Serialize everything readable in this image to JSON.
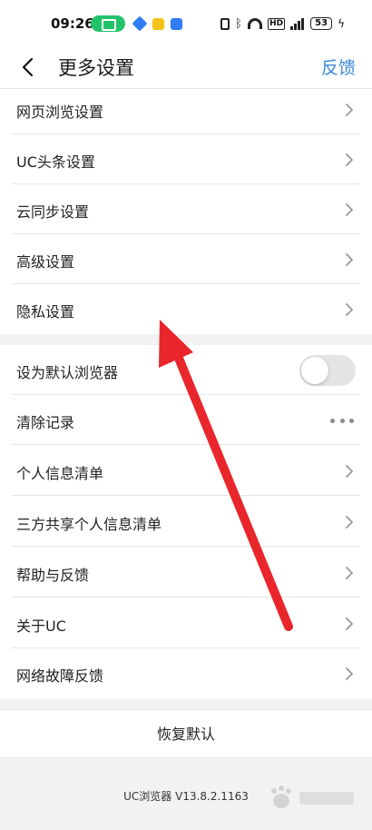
{
  "status_bar": {
    "time": "09:26",
    "battery": "53",
    "hd_badge": "HD"
  },
  "app_bar": {
    "title": "更多设置",
    "feedback": "反馈"
  },
  "group1": [
    {
      "label": "网页浏览设置"
    },
    {
      "label": "UC头条设置"
    },
    {
      "label": "云同步设置"
    },
    {
      "label": "高级设置"
    },
    {
      "label": "隐私设置"
    }
  ],
  "group2": {
    "default_browser": {
      "label": "设为默认浏览器",
      "enabled": false
    },
    "clear_records": {
      "label": "清除记录"
    },
    "personal_info": {
      "label": "个人信息清单"
    },
    "third_party_info": {
      "label": "三方共享个人信息清单"
    },
    "help_feedback": {
      "label": "帮助与反馈"
    },
    "about_uc": {
      "label": "关于UC"
    },
    "network_feedback": {
      "label": "网络故障反馈"
    }
  },
  "footer": {
    "restore_default": "恢复默认",
    "version": "UC浏览器 V13.8.2.1163"
  },
  "colors": {
    "accent": "#3a8ad8",
    "arrow": "#e8262c",
    "toggle_off": "#e4e4e4"
  }
}
